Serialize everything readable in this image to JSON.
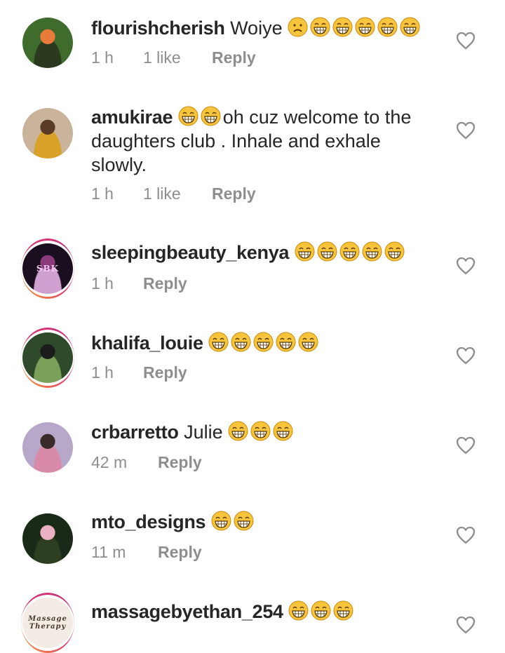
{
  "comments": [
    {
      "username": "flourishcherish",
      "text": "Woiye",
      "emojis": [
        "sad",
        "grin",
        "grin",
        "grin",
        "grin",
        "grin"
      ],
      "emoji_position": "after",
      "time": "1 h",
      "likes": "1 like",
      "reply": "Reply",
      "story": false,
      "avatar_colors": [
        "#3f6b2c",
        "#e87a3a",
        "#2b3a1f"
      ]
    },
    {
      "username": "amukirae",
      "text": "oh cuz welcome to the daughters club . Inhale and exhale slowly.",
      "emojis": [
        "grin",
        "grin"
      ],
      "emoji_position": "before",
      "time": "1 h",
      "likes": "1 like",
      "reply": "Reply",
      "story": false,
      "avatar_colors": [
        "#c9b39a",
        "#5a3b28",
        "#d9a12a"
      ]
    },
    {
      "username": "sleepingbeauty_kenya",
      "text": "",
      "emojis": [
        "grin",
        "grin",
        "grin",
        "grin",
        "grin"
      ],
      "emoji_position": "after",
      "time": "1 h",
      "likes": "",
      "reply": "Reply",
      "story": true,
      "avatar_colors": [
        "#1a0f1e",
        "#8a3a7a",
        "#d0a0d0"
      ],
      "avatar_text": "SBK"
    },
    {
      "username": "khalifa_louie",
      "text": "",
      "emojis": [
        "grin",
        "grin",
        "grin",
        "grin",
        "grin"
      ],
      "emoji_position": "after",
      "time": "1 h",
      "likes": "",
      "reply": "Reply",
      "story": true,
      "avatar_colors": [
        "#2e4a2a",
        "#1c1c1c",
        "#7aa05a"
      ]
    },
    {
      "username": "crbarretto",
      "text": "Julie",
      "emojis": [
        "grin",
        "grin",
        "grin"
      ],
      "emoji_position": "after",
      "time": "42 m",
      "likes": "",
      "reply": "Reply",
      "story": false,
      "avatar_colors": [
        "#b7a8c9",
        "#3a2a2a",
        "#d88aa8"
      ]
    },
    {
      "username": "mto_designs",
      "text": "",
      "emojis": [
        "grin",
        "grin"
      ],
      "emoji_position": "after",
      "time": "11 m",
      "likes": "",
      "reply": "Reply",
      "story": false,
      "avatar_colors": [
        "#1a2a18",
        "#e8b0c0",
        "#2e3e20"
      ]
    },
    {
      "username": "massagebyethan_254",
      "text": "",
      "emojis": [
        "grin",
        "grin",
        "grin"
      ],
      "emoji_position": "after",
      "time": "",
      "likes": "",
      "reply": "",
      "story": true,
      "avatar_colors": [
        "#f3ece4",
        "#6b4a3a",
        "#a08070"
      ],
      "avatar_text": "Massage Therapy"
    }
  ],
  "colors": {
    "emoji_face": "#f7c43c",
    "emoji_outline": "#c98a10",
    "meta": "#8e8e8e",
    "heart": "#8e8e8e"
  },
  "icons": {
    "like": "heart-icon"
  }
}
